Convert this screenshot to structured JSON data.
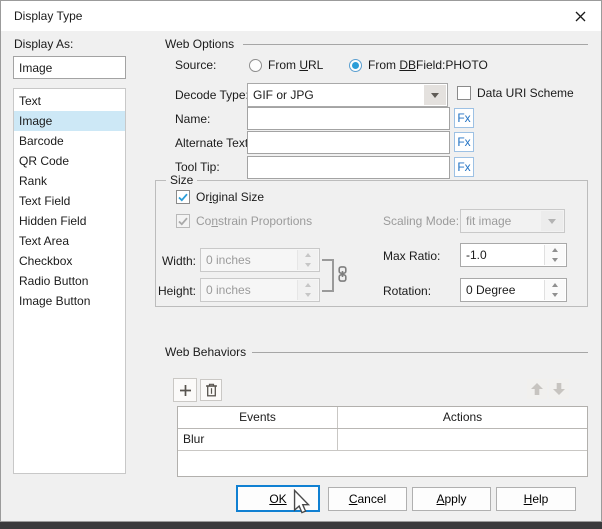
{
  "title_bar": {
    "title": "Display Type"
  },
  "colors": {
    "accent_blue": "#2b9dd8",
    "focus_border": "#1080d2",
    "selection_bg": "#cde8f6",
    "dialog_bg": "#f0f0f0",
    "titlebar_bg": "#ffffff",
    "bottom_strip": "#3a3a3c",
    "fx_blue": "#2272c3"
  },
  "icons": {
    "close": "✕",
    "plus": "+",
    "trash": "trash-can",
    "move_up": "arrow-up",
    "move_down": "arrow-down",
    "chain": "chain-link",
    "dropdown_arrow": "▼",
    "spin_up": "▲",
    "spin_down": "▼",
    "check": "✓",
    "radio_dot": "●",
    "cursor": "arrow-pointer"
  },
  "left_panel": {
    "label": "Display As:",
    "value": "Image",
    "items": [
      "Text",
      "Image",
      "Barcode",
      "QR Code",
      "Rank",
      "Text Field",
      "Hidden Field",
      "Text Area",
      "Checkbox",
      "Radio Button",
      "Image Button"
    ],
    "selected_item": "Image"
  },
  "web_options": {
    "heading": "Web Options",
    "source_label": "Source:",
    "radio_from_url": {
      "pre": "From ",
      "mn": "U",
      "post": "RL",
      "selected": false
    },
    "radio_from_dbfield": {
      "pre": "From ",
      "mn": "DB",
      "post": "Field:PHOTO",
      "selected": true
    },
    "decode_type_label": "Decode Type:",
    "decode_type_value": "GIF or JPG",
    "data_uri_label": "Data URI Scheme",
    "data_uri_checked": false,
    "name_label": "Name:",
    "name_value": "",
    "alternate_text_label": "Alternate Text:",
    "alternate_text_value": "",
    "tool_tip_label": "Tool Tip:",
    "tool_tip_value": "",
    "fx_button_label": "Fx"
  },
  "size_group": {
    "heading": "Size",
    "original_size": {
      "pre": "Or",
      "mn": "i",
      "post": "ginal Size",
      "checked": true
    },
    "constrain_proportions": {
      "pre": "Co",
      "mn": "n",
      "post": "strain Proportions",
      "checked": true,
      "disabled": true
    },
    "width_label": "Width:",
    "width_value": "0 inches",
    "height_label": "Height:",
    "height_value": "0 inches",
    "scaling_mode_label": "Scaling Mode:",
    "scaling_mode_value": "fit image",
    "max_ratio_label": "Max Ratio:",
    "max_ratio_value": "-1.0",
    "rotation_label": "Rotation:",
    "rotation_value": "0 Degree"
  },
  "web_behaviors": {
    "heading": "Web Behaviors",
    "columns": [
      "Events",
      "Actions"
    ],
    "rows": [
      {
        "event": "Blur",
        "action": ""
      }
    ]
  },
  "footer": {
    "ok": {
      "pre": "",
      "mn": "OK",
      "post": ""
    },
    "cancel": {
      "pre": "",
      "mn": "C",
      "post": "ancel"
    },
    "apply": {
      "pre": "",
      "mn": "A",
      "post": "pply"
    },
    "help": {
      "pre": "",
      "mn": "H",
      "post": "elp"
    }
  }
}
